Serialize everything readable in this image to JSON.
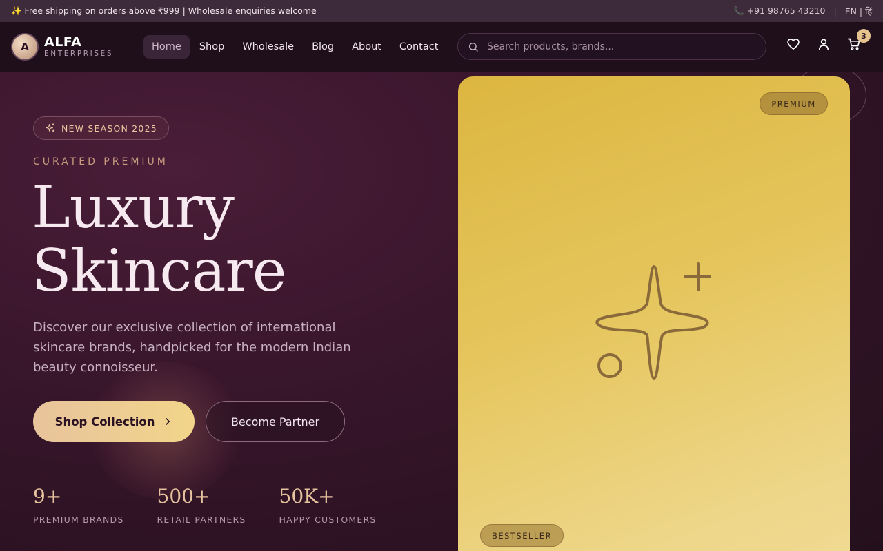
{
  "topbar": {
    "announcement": "✨ Free shipping on orders above ₹999 | Wholesale enquiries welcome",
    "phone": "📞 +91 98765 43210",
    "separator": "|",
    "language": "EN | हिं"
  },
  "header": {
    "logo_letter": "A",
    "brand_name": "ALFA",
    "brand_sub": "ENTERPRISES",
    "nav": [
      "Home",
      "Shop",
      "Wholesale",
      "Blog",
      "About",
      "Contact"
    ],
    "active_nav": "Home",
    "search_placeholder": "Search products, brands...",
    "cart_count": "3"
  },
  "hero": {
    "tag": "NEW SEASON 2025",
    "eyebrow": "CURATED PREMIUM",
    "title_line1": "Luxury",
    "title_line2": "Skincare",
    "description": "Discover our exclusive collection of international skincare brands, handpicked for the modern Indian beauty connoisseur.",
    "primary_button": "Shop Collection",
    "secondary_button": "Become Partner",
    "stats": [
      {
        "value": "9+",
        "label": "PREMIUM BRANDS"
      },
      {
        "value": "500+",
        "label": "RETAIL PARTNERS"
      },
      {
        "value": "50K+",
        "label": "HAPPY CUSTOMERS"
      }
    ]
  },
  "card": {
    "badge_top": "PREMIUM",
    "badge_bottom": "BESTSELLER"
  },
  "colors": {
    "accent_gold": "#e6c39e",
    "card_gold": "#e5c55c",
    "background": "#2a1222"
  }
}
